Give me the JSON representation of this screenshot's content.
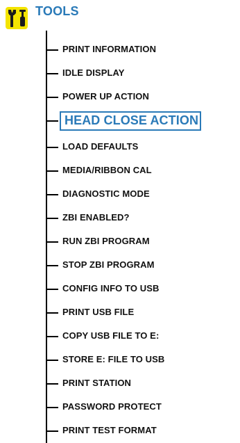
{
  "header": {
    "title": "TOOLS",
    "icon": "tools-icon",
    "icon_colors": {
      "background": "#f4e400",
      "tools": "#2a7ab8"
    }
  },
  "menu": {
    "items": [
      {
        "label": "PRINT INFORMATION"
      },
      {
        "label": "IDLE DISPLAY"
      },
      {
        "label": "POWER UP ACTION"
      },
      {
        "label": "HEAD CLOSE ACTION",
        "selected": true
      },
      {
        "label": "LOAD DEFAULTS"
      },
      {
        "label": "MEDIA/RIBBON CAL"
      },
      {
        "label": "DIAGNOSTIC MODE"
      },
      {
        "label": "ZBI ENABLED?"
      },
      {
        "label": "RUN ZBI PROGRAM"
      },
      {
        "label": "STOP ZBI PROGRAM"
      },
      {
        "label": "CONFIG INFO TO USB"
      },
      {
        "label": "PRINT USB FILE"
      },
      {
        "label": "COPY USB FILE TO E:"
      },
      {
        "label": "STORE E: FILE TO USB"
      },
      {
        "label": "PRINT STATION"
      },
      {
        "label": "PASSWORD PROTECT"
      },
      {
        "label": "PRINT TEST FORMAT"
      }
    ],
    "selected_color": "#2a7ab8"
  }
}
